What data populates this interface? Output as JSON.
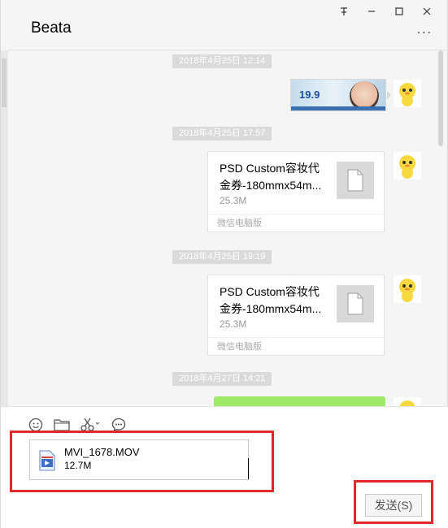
{
  "window": {
    "title": "Beata",
    "controls": [
      "pin-icon",
      "minimize-icon",
      "maximize-icon",
      "close-icon"
    ]
  },
  "header": {
    "more_label": "..."
  },
  "messages": [
    {
      "type": "timestamp",
      "text": "2018年4月25日 12:14"
    },
    {
      "type": "image",
      "sender": "me",
      "preview_text": "19.9"
    },
    {
      "type": "timestamp",
      "text": "2018年4月25日 17:57"
    },
    {
      "type": "file",
      "sender": "me",
      "name_line1": "PSD Custom容妆代",
      "name_line2": "金券-180mmx54m...",
      "size": "25.3M",
      "source": "微信电脑版"
    },
    {
      "type": "timestamp",
      "text": "2018年4月25日 19:19"
    },
    {
      "type": "file",
      "sender": "me",
      "name_line1": "PSD Custom容妆代",
      "name_line2": "金券-180mmx54m...",
      "size": "25.3M",
      "source": "微信电脑版"
    },
    {
      "type": "timestamp",
      "text": "2018年4月27日 14:21"
    },
    {
      "type": "text",
      "sender": "me",
      "bubble_color": "#9eea6a"
    }
  ],
  "toolbar": {
    "tools": [
      "emoji-icon",
      "folder-icon",
      "scissors-icon",
      "chat-history-icon"
    ]
  },
  "composer": {
    "attachment_name": "MVI_1678.MOV",
    "attachment_size": "12.7M",
    "send_label": "发送(S)"
  },
  "colors": {
    "highlight": "#e02a2a",
    "my_bubble": "#9eea6a",
    "timestamp_bg": "#dadada"
  }
}
